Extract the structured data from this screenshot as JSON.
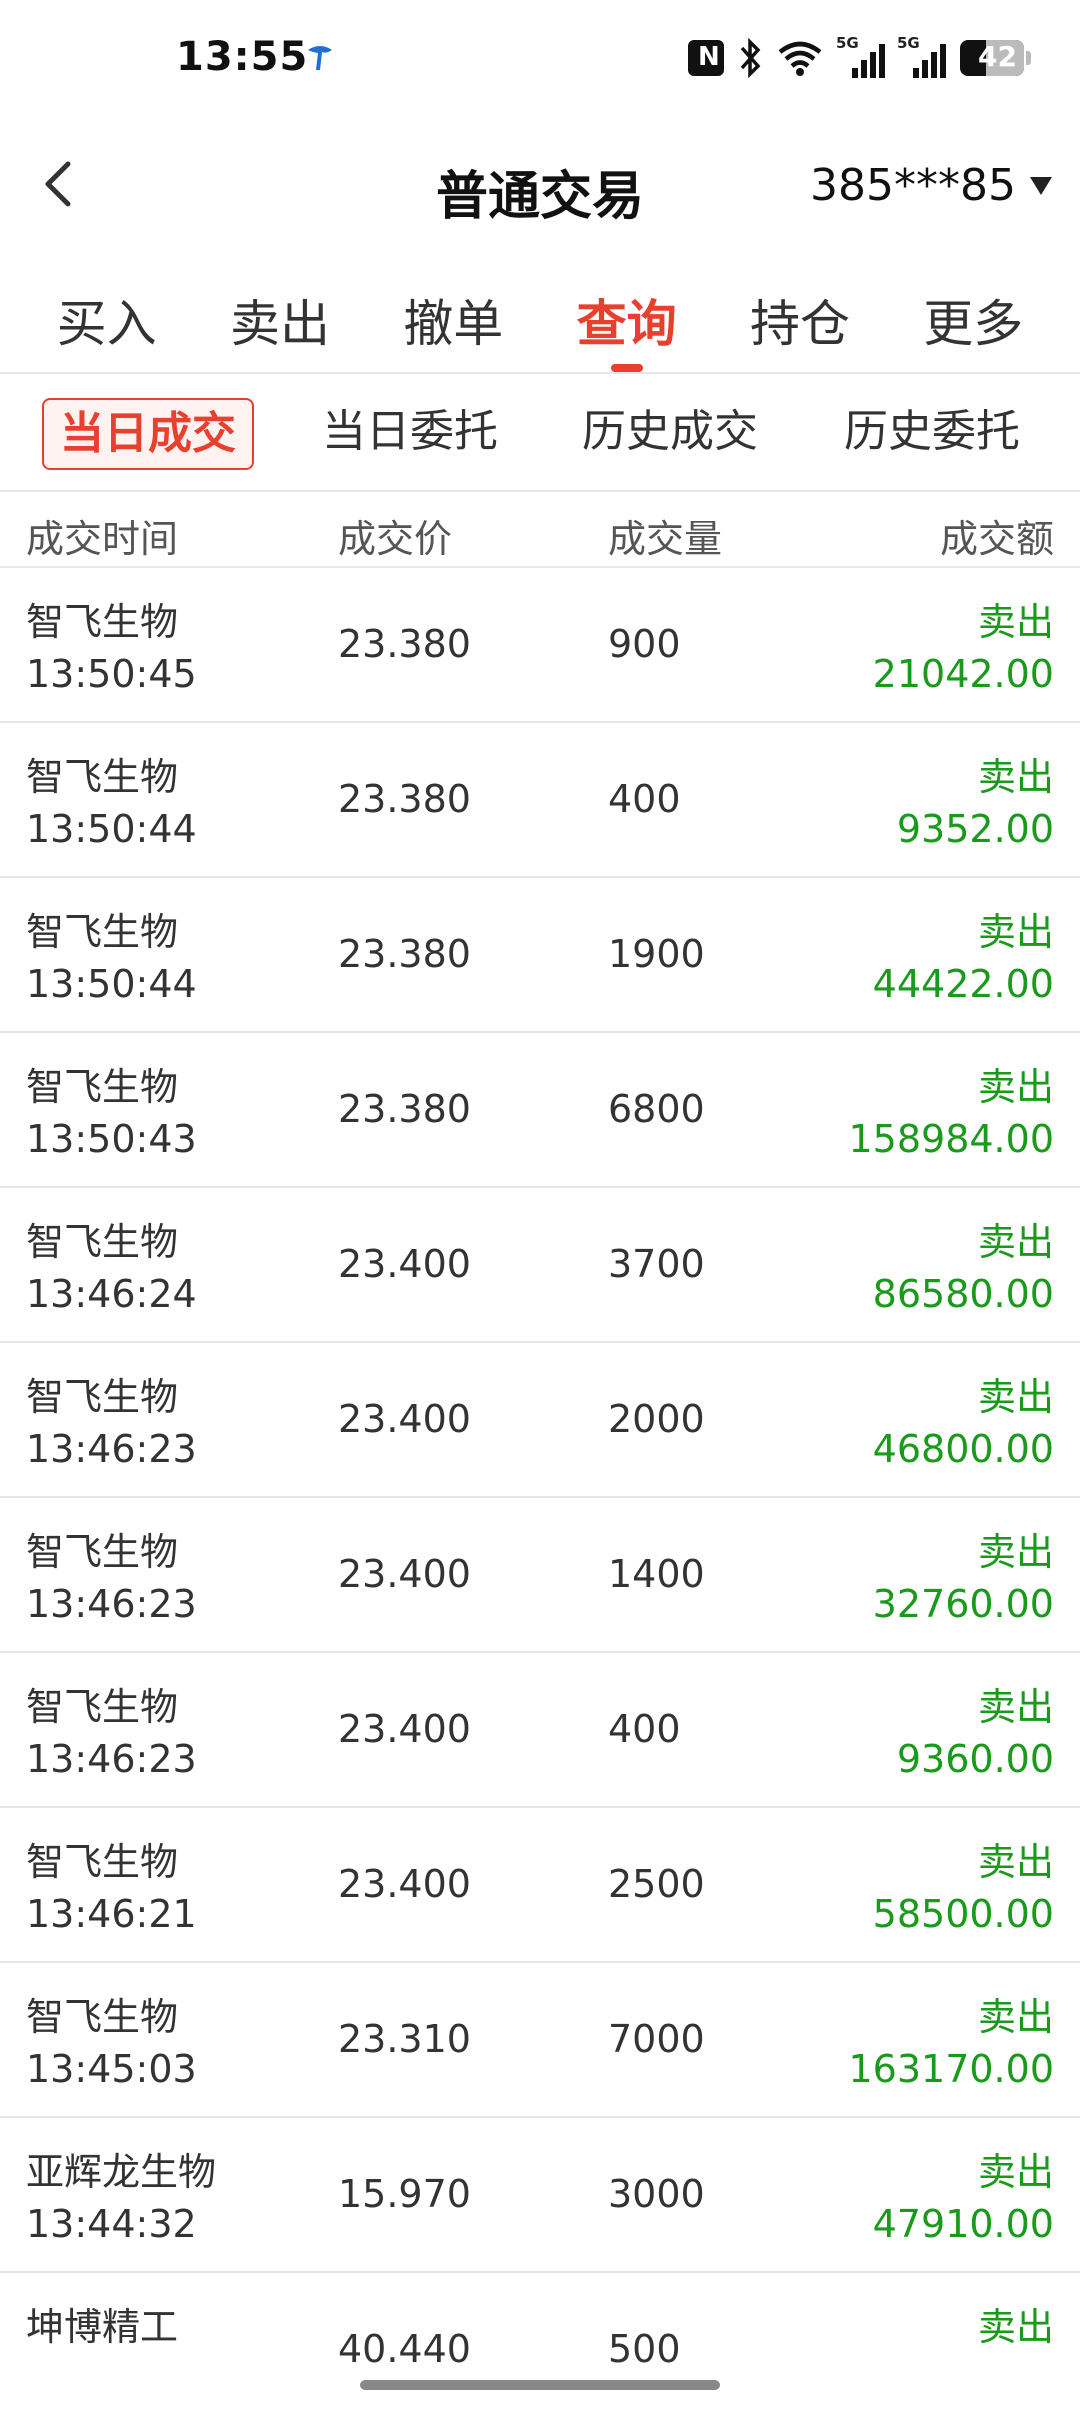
{
  "status_bar": {
    "time": "13:55",
    "battery": "42"
  },
  "header": {
    "title": "普通交易",
    "account": "385***85"
  },
  "main_tabs": [
    {
      "label": "买入"
    },
    {
      "label": "卖出"
    },
    {
      "label": "撤单"
    },
    {
      "label": "查询"
    },
    {
      "label": "持仓"
    },
    {
      "label": "更多"
    }
  ],
  "sub_tabs": [
    {
      "label": "当日成交"
    },
    {
      "label": "当日委托"
    },
    {
      "label": "历史成交"
    },
    {
      "label": "历史委托"
    }
  ],
  "table": {
    "columns": [
      "成交时间",
      "成交价",
      "成交量",
      "成交额"
    ],
    "rows": [
      {
        "name": "智飞生物",
        "time": "13:50:45",
        "price": "23.380",
        "qty": "900",
        "side": "卖出",
        "amount": "21042.00"
      },
      {
        "name": "智飞生物",
        "time": "13:50:44",
        "price": "23.380",
        "qty": "400",
        "side": "卖出",
        "amount": "9352.00"
      },
      {
        "name": "智飞生物",
        "time": "13:50:44",
        "price": "23.380",
        "qty": "1900",
        "side": "卖出",
        "amount": "44422.00"
      },
      {
        "name": "智飞生物",
        "time": "13:50:43",
        "price": "23.380",
        "qty": "6800",
        "side": "卖出",
        "amount": "158984.00"
      },
      {
        "name": "智飞生物",
        "time": "13:46:24",
        "price": "23.400",
        "qty": "3700",
        "side": "卖出",
        "amount": "86580.00"
      },
      {
        "name": "智飞生物",
        "time": "13:46:23",
        "price": "23.400",
        "qty": "2000",
        "side": "卖出",
        "amount": "46800.00"
      },
      {
        "name": "智飞生物",
        "time": "13:46:23",
        "price": "23.400",
        "qty": "1400",
        "side": "卖出",
        "amount": "32760.00"
      },
      {
        "name": "智飞生物",
        "time": "13:46:23",
        "price": "23.400",
        "qty": "400",
        "side": "卖出",
        "amount": "9360.00"
      },
      {
        "name": "智飞生物",
        "time": "13:46:21",
        "price": "23.400",
        "qty": "2500",
        "side": "卖出",
        "amount": "58500.00"
      },
      {
        "name": "智飞生物",
        "time": "13:45:03",
        "price": "23.310",
        "qty": "7000",
        "side": "卖出",
        "amount": "163170.00"
      },
      {
        "name": "亚辉龙生物",
        "time": "13:44:32",
        "price": "15.970",
        "qty": "3000",
        "side": "卖出",
        "amount": "47910.00"
      },
      {
        "name": "坤博精工",
        "time": "",
        "price": "40.440",
        "qty": "500",
        "side": "卖出",
        "amount": ""
      }
    ]
  },
  "colors": {
    "accent": "#e8402f",
    "sell": "#1a9a1a"
  }
}
